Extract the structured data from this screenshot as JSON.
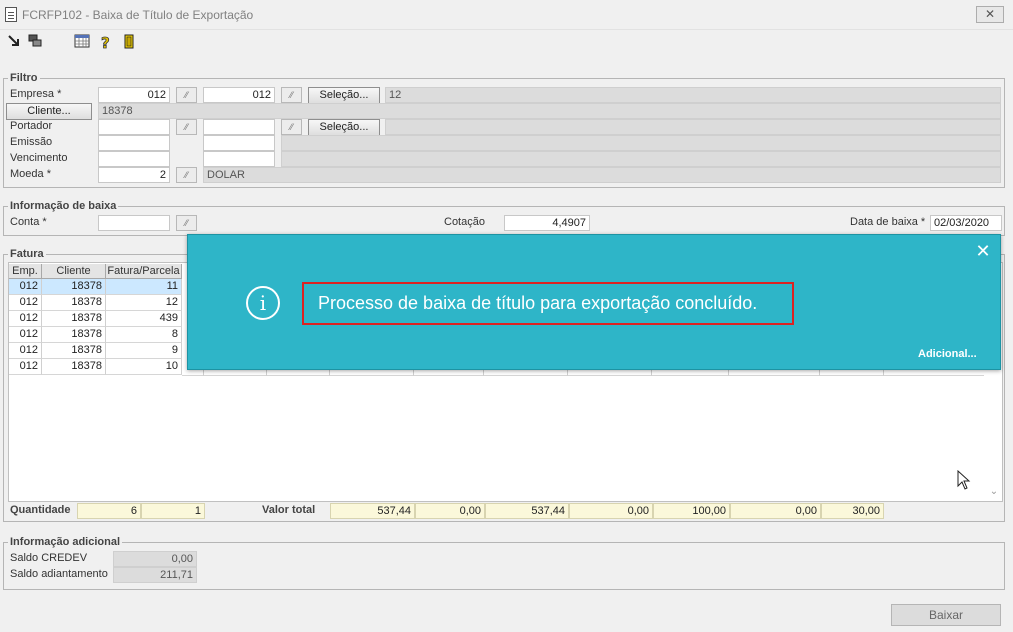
{
  "window": {
    "title": "FCRFP102 - Baixa de Título de Exportação",
    "close_glyph": "✕"
  },
  "toolbar": {
    "icons": [
      "exit-arrow-icon",
      "windows-icon",
      "calendar-icon",
      "help-icon",
      "door-exit-icon"
    ]
  },
  "filtro": {
    "legend": "Filtro",
    "empresa": {
      "label": "Empresa *",
      "from": "012",
      "to": "012",
      "button": "Seleção...",
      "selection": "12"
    },
    "cliente": {
      "button": "Cliente...",
      "value": "18378"
    },
    "portador": {
      "label": "Portador",
      "from": "",
      "to": "",
      "button": "Seleção...",
      "selection": ""
    },
    "emissao": {
      "label": "Emissão",
      "from": "",
      "to": ""
    },
    "vencimento": {
      "label": "Vencimento",
      "from": "",
      "to": ""
    },
    "moeda": {
      "label": "Moeda *",
      "value": "2",
      "description": "DOLAR"
    }
  },
  "info_baixa": {
    "legend": "Informação de baixa",
    "conta": {
      "label": "Conta *",
      "value": ""
    },
    "cotacao": {
      "label": "Cotação",
      "value": "4,4907"
    },
    "data_baixa": {
      "label": "Data de baixa *",
      "value": "02/03/2020"
    }
  },
  "fatura": {
    "legend": "Fatura",
    "columns": [
      "Emp.",
      "Cliente",
      "Fatura/Parcela"
    ],
    "rows": [
      [
        "012",
        "18378",
        "11"
      ],
      [
        "012",
        "18378",
        "12"
      ],
      [
        "012",
        "18378",
        "439"
      ],
      [
        "012",
        "18378",
        "8"
      ],
      [
        "012",
        "18378",
        "9"
      ],
      [
        "012",
        "18378",
        "10"
      ]
    ]
  },
  "totais": {
    "quantidade_label": "Quantidade",
    "quantidade": "6",
    "quantidade2": "1",
    "valor_total_label": "Valor total",
    "values": [
      "537,44",
      "0,00",
      "537,44",
      "0,00",
      "100,00",
      "0,00",
      "30,00"
    ]
  },
  "info_adicional": {
    "legend": "Informação adicional",
    "saldo_credev": {
      "label": "Saldo CREDEV",
      "value": "0,00"
    },
    "saldo_adiantamento": {
      "label": "Saldo adiantamento",
      "value": "211,71"
    }
  },
  "toast": {
    "message": "Processo de baixa de título para exportação concluído.",
    "more": "Adicional...",
    "info_glyph": "i",
    "close_glyph": "✕",
    "background": "#2eb5c8"
  },
  "actions": {
    "baixar": "Baixar"
  }
}
